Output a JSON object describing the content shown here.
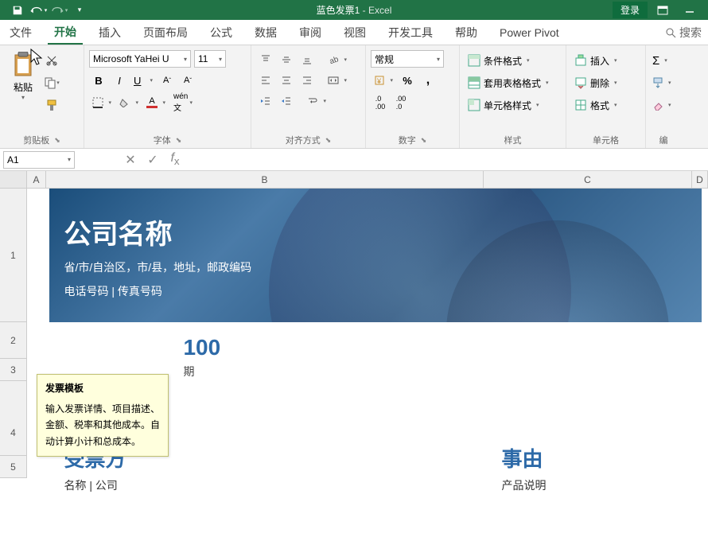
{
  "titlebar": {
    "filename": "蓝色发票1",
    "appname": "Excel",
    "login": "登录"
  },
  "tabs": {
    "file": "文件",
    "home": "开始",
    "insert": "插入",
    "layout": "页面布局",
    "formula": "公式",
    "data": "数据",
    "review": "审阅",
    "view": "视图",
    "dev": "开发工具",
    "help": "帮助",
    "pp": "Power Pivot",
    "search": "搜索"
  },
  "ribbon": {
    "clipboard": {
      "paste": "粘贴",
      "group": "剪贴板"
    },
    "font": {
      "name": "Microsoft YaHei U",
      "size": "11",
      "group": "字体"
    },
    "align": {
      "group": "对齐方式"
    },
    "number": {
      "format": "常规",
      "group": "数字"
    },
    "styles": {
      "cond": "条件格式",
      "table": "套用表格格式",
      "cell": "单元格样式",
      "group": "样式"
    },
    "cells": {
      "insert": "插入",
      "delete": "删除",
      "format": "格式",
      "group": "单元格"
    },
    "editing": {
      "group": "编"
    }
  },
  "namebox": "A1",
  "columns": {
    "A": "A",
    "B": "B",
    "C": "C",
    "D": "D"
  },
  "rows": {
    "r1": "1",
    "r2": "2",
    "r3": "3",
    "r4": "4",
    "r5": "5"
  },
  "invoice": {
    "company": "公司名称",
    "address": "省/市/自治区，市/县，地址，邮政编码",
    "phone": "电话号码 | 传真号码",
    "number_vis": "100",
    "date_vis": "期",
    "billto": "受票方",
    "billto_sub": "名称 | 公司",
    "for": "事由",
    "for_sub": "产品说明"
  },
  "tooltip": {
    "title": "发票模板",
    "body": "输入发票详情、项目描述、金额、税率和其他成本。自动计算小计和总成本。"
  }
}
